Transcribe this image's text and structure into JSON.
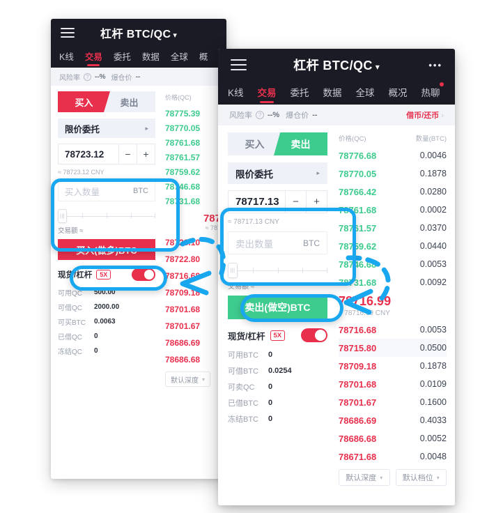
{
  "app": {
    "title": "杠杆 BTC/QC",
    "caret": "▾",
    "menu_icon": "hamburger-icon",
    "more_icon": "more-dots-icon",
    "more_label": "•••"
  },
  "tabs_left": [
    "K线",
    "交易",
    "委托",
    "数据",
    "全球",
    "概"
  ],
  "tabs_right": [
    "K线",
    "交易",
    "委托",
    "数据",
    "全球",
    "概况",
    "热聊"
  ],
  "active_tab": "交易",
  "risk": {
    "label": "风险率",
    "help": "?",
    "rate": "--%",
    "liq_label": "爆仓价",
    "liq_value": "--",
    "borrow_link": "借币/还币",
    "chevron": "›"
  },
  "left_panel": {
    "tab_buy": "买入",
    "tab_sell": "卖出",
    "active_side": "buy",
    "order_type": "限价委托",
    "order_type_arrow": "▸",
    "price": "78723.12",
    "minus": "−",
    "plus": "+",
    "approx_symbol": "≈",
    "cny_hint": "78723.12 CNY",
    "amount_placeholder": "买入数量",
    "amount_unit": "BTC",
    "slider_knob": "|||",
    "turnover_label": "交易额 ≈",
    "action_label": "买入(做多)BTC",
    "leverage_label_spot": "现货",
    "leverage_label_sep": "/",
    "leverage_label_lev": "杠杆",
    "leverage_badge": "5X",
    "toggle_on": true,
    "stats": [
      {
        "k": "可用QC",
        "v": "500.00"
      },
      {
        "k": "可借QC",
        "v": "2000.00"
      },
      {
        "k": "可买BTC",
        "v": "0.0063"
      },
      {
        "k": "已借QC",
        "v": "0"
      },
      {
        "k": "冻结QC",
        "v": "0"
      }
    ],
    "orderbook": {
      "price_header": "价格(QC)",
      "asks": [
        "78775.39",
        "78770.05",
        "78761.68",
        "78761.57",
        "78759.62",
        "78746.68",
        "78731.68"
      ],
      "last_price": "787",
      "last_cny": "≈ 787",
      "bids": [
        "78723.10",
        "78722.80",
        "78716.68",
        "78709.18",
        "78701.68",
        "78701.67",
        "78686.69",
        "78686.68"
      ],
      "depth_select": "默认深度",
      "depth_caret": "▾"
    }
  },
  "right_panel": {
    "tab_buy": "买入",
    "tab_sell": "卖出",
    "active_side": "sell",
    "order_type": "限价委托",
    "order_type_arrow": "▸",
    "price": "78717.13",
    "minus": "−",
    "plus": "+",
    "approx_symbol": "≈",
    "cny_hint": "78717.13 CNY",
    "amount_placeholder": "卖出数量",
    "amount_unit": "BTC",
    "slider_knob": "|||",
    "turnover_label": "交易额 ≈",
    "action_label": "卖出(做空)BTC",
    "leverage_label_spot": "现货",
    "leverage_label_sep": "/",
    "leverage_label_lev": "杠杆",
    "leverage_badge": "5X",
    "toggle_on": true,
    "stats": [
      {
        "k": "可用BTC",
        "v": "0"
      },
      {
        "k": "可借BTC",
        "v": "0.0254"
      },
      {
        "k": "可卖QC",
        "v": "0"
      },
      {
        "k": "已借BTC",
        "v": "0"
      },
      {
        "k": "冻结BTC",
        "v": "0"
      }
    ],
    "orderbook": {
      "price_header": "价格(QC)",
      "amount_header": "数量(BTC)",
      "asks": [
        {
          "p": "78776.68",
          "a": "0.0046"
        },
        {
          "p": "78770.05",
          "a": "0.1878"
        },
        {
          "p": "78766.42",
          "a": "0.0280"
        },
        {
          "p": "78761.68",
          "a": "0.0002"
        },
        {
          "p": "78761.57",
          "a": "0.0370"
        },
        {
          "p": "78759.62",
          "a": "0.0440"
        },
        {
          "p": "78746.68",
          "a": "0.0053"
        },
        {
          "p": "78731.68",
          "a": "0.0092"
        }
      ],
      "last_price": "78716.99",
      "last_cny": "≈ 78716.99 CNY",
      "bids": [
        {
          "p": "78716.68",
          "a": "0.0053"
        },
        {
          "p": "78715.80",
          "a": "0.0500"
        },
        {
          "p": "78709.18",
          "a": "0.1878"
        },
        {
          "p": "78701.68",
          "a": "0.0109"
        },
        {
          "p": "78701.67",
          "a": "0.1600"
        },
        {
          "p": "78686.69",
          "a": "0.4033"
        },
        {
          "p": "78686.68",
          "a": "0.0052"
        },
        {
          "p": "78671.68",
          "a": "0.0048"
        }
      ],
      "depth_select": "默认深度",
      "depth_caret": "▾",
      "level_select": "默认档位",
      "level_caret": "▾"
    }
  },
  "colors": {
    "accent_red": "#e8304d",
    "accent_green": "#3ecb8e",
    "annotation_blue": "#19A7F0",
    "topbar_dark": "#1b1b25"
  }
}
